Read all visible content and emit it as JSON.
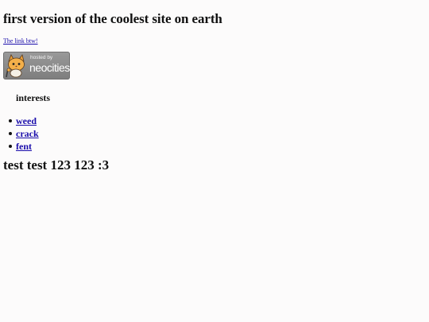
{
  "page": {
    "title": "first version of the coolest site on earth",
    "link_text": "The link btw!",
    "badge": {
      "hosted_text": "hosted by",
      "brand_text": "neocities",
      "icon": "neocities-cat-icon",
      "color": "#8a8a8a"
    },
    "interests_heading": "interests",
    "interests": [
      {
        "label": "weed"
      },
      {
        "label": "crack"
      },
      {
        "label": "fent"
      }
    ],
    "closing_text": "test test 123 123 :3"
  },
  "colors": {
    "background": "#fcfbfb",
    "link": "#1a0dab",
    "text": "#111111"
  }
}
